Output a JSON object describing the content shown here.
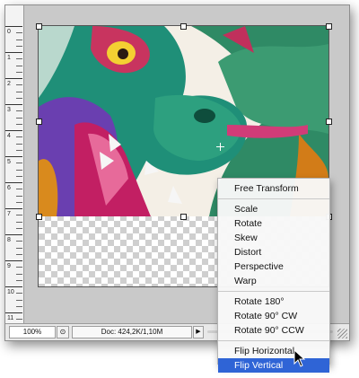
{
  "status_bar": {
    "zoom": "100%",
    "doc_info": "Doc: 424,2K/1,10M"
  },
  "context_menu": {
    "items": [
      {
        "label": "Free Transform"
      },
      {
        "label": "Scale"
      },
      {
        "label": "Rotate"
      },
      {
        "label": "Skew"
      },
      {
        "label": "Distort"
      },
      {
        "label": "Perspective"
      },
      {
        "label": "Warp"
      },
      {
        "label": "Rotate 180°"
      },
      {
        "label": "Rotate 90° CW"
      },
      {
        "label": "Rotate 90° CCW"
      },
      {
        "label": "Flip Horizontal"
      },
      {
        "label": "Flip Vertical"
      }
    ],
    "selected": "Flip Vertical",
    "selection_color": "#2f64d6"
  },
  "ruler": {
    "labels": [
      "0",
      "1",
      "2",
      "3",
      "4",
      "5",
      "6",
      "7",
      "8",
      "9",
      "10",
      "11"
    ]
  },
  "icons": [
    "transform-handle-icon",
    "reference-point-icon",
    "status-info-icon",
    "status-menu-arrow-icon",
    "resize-grip-icon",
    "mouse-cursor-icon"
  ]
}
